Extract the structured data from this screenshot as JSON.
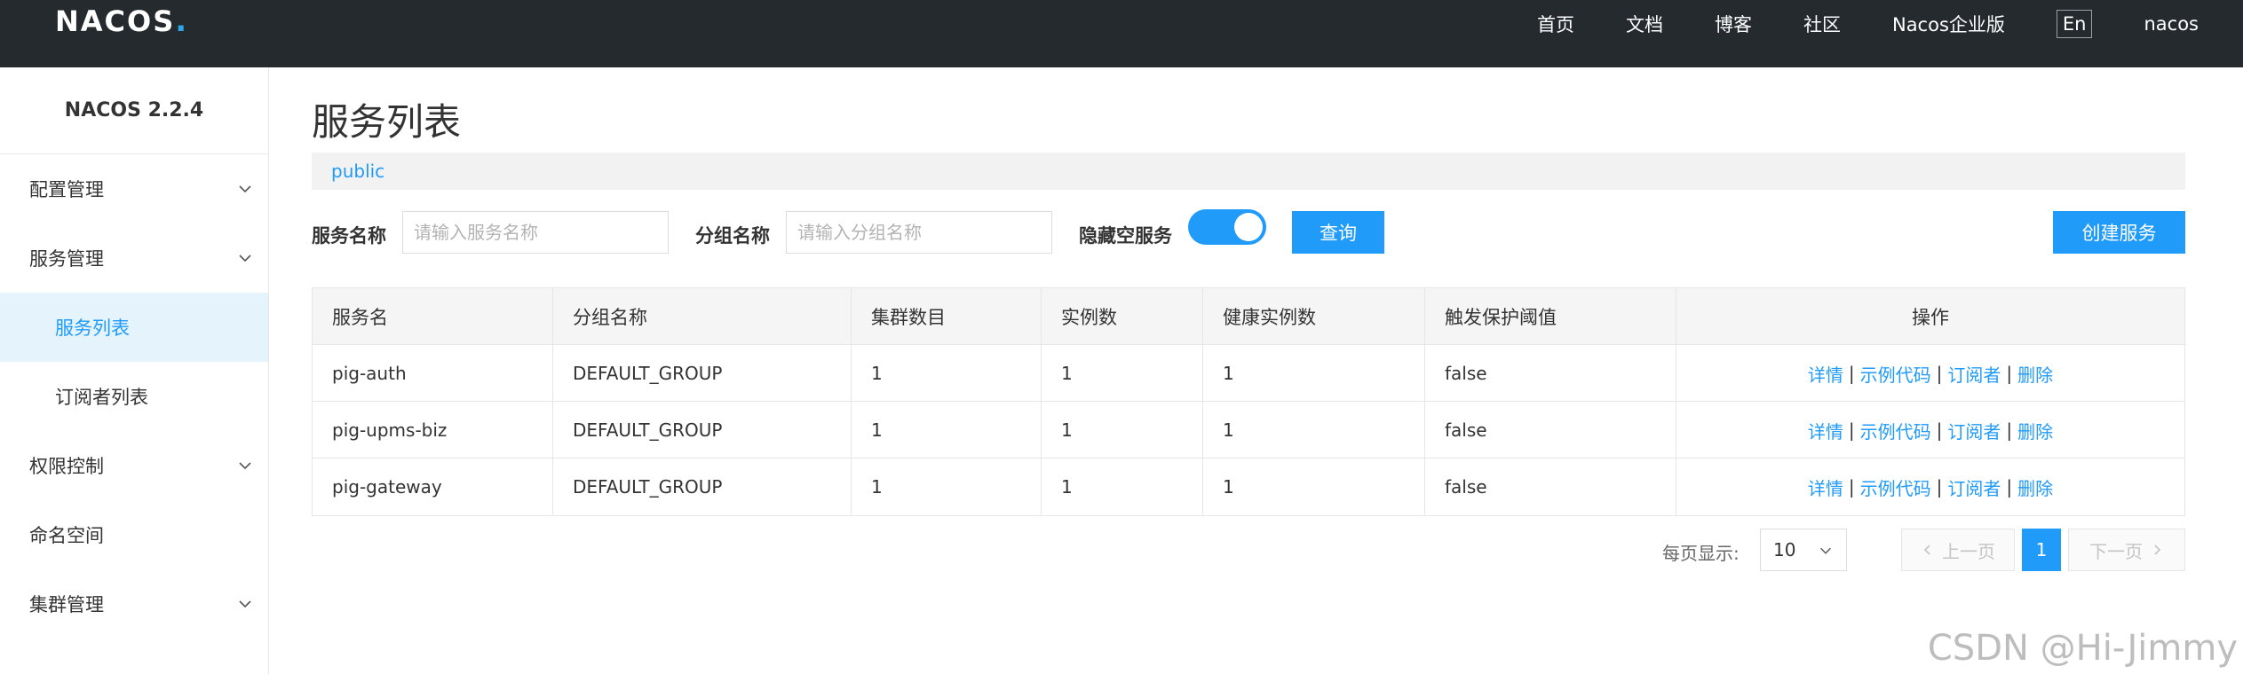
{
  "header": {
    "logo_text": "NACOS",
    "logo_dot": ".",
    "nav": [
      "首页",
      "文档",
      "博客",
      "社区",
      "Nacos企业版"
    ],
    "lang_button": "En",
    "user": "nacos"
  },
  "sidebar": {
    "version": "NACOS 2.2.4",
    "items": [
      {
        "label": "配置管理",
        "expandable": true
      },
      {
        "label": "服务管理",
        "expandable": true,
        "expanded": true
      },
      {
        "label": "服务列表",
        "sub": true,
        "active": true
      },
      {
        "label": "订阅者列表",
        "sub": true
      },
      {
        "label": "权限控制",
        "expandable": true
      },
      {
        "label": "命名空间",
        "expandable": false
      },
      {
        "label": "集群管理",
        "expandable": true
      }
    ]
  },
  "main": {
    "title": "服务列表",
    "namespace": "public",
    "filters": {
      "service_name_label": "服务名称",
      "service_name_placeholder": "请输入服务名称",
      "group_name_label": "分组名称",
      "group_name_placeholder": "请输入分组名称",
      "hide_empty_label": "隐藏空服务",
      "hide_empty_on": true,
      "query_button": "查询",
      "create_button": "创建服务"
    },
    "table": {
      "columns": [
        "服务名",
        "分组名称",
        "集群数目",
        "实例数",
        "健康实例数",
        "触发保护阈值",
        "操作"
      ],
      "rows": [
        [
          "pig-auth",
          "DEFAULT_GROUP",
          "1",
          "1",
          "1",
          "false"
        ],
        [
          "pig-upms-biz",
          "DEFAULT_GROUP",
          "1",
          "1",
          "1",
          "false"
        ],
        [
          "pig-gateway",
          "DEFAULT_GROUP",
          "1",
          "1",
          "1",
          "false"
        ]
      ],
      "actions": [
        "详情",
        "示例代码",
        "订阅者",
        "删除"
      ],
      "action_separator": "|"
    },
    "pagination": {
      "page_size_label": "每页显示:",
      "page_size": "10",
      "prev": "上一页",
      "next": "下一页",
      "current_page": "1"
    }
  },
  "watermark": "CSDN @Hi-Jimmy",
  "colors": {
    "topbar": "#252a2f",
    "accent": "#209bfa",
    "active_bg": "#e5f3fd"
  }
}
